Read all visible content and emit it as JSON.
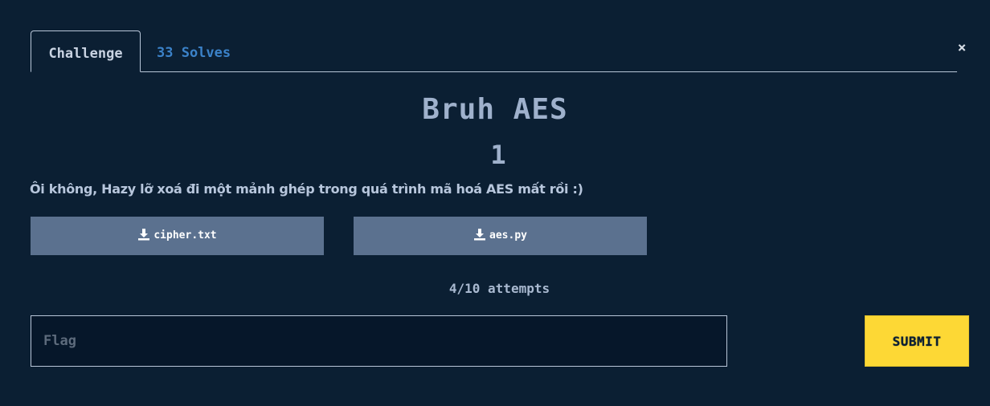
{
  "tabs": {
    "challenge_label": "Challenge",
    "solves_label": "33 Solves"
  },
  "close_icon": "×",
  "challenge": {
    "name": "Bruh AES",
    "points": "1",
    "description": "Ôi không, Hazy lỡ xoá đi một mảnh ghép trong quá trình mã hoá AES mất rồi :)"
  },
  "files": [
    {
      "name": "cipher.txt",
      "icon": "download-icon"
    },
    {
      "name": "aes.py",
      "icon": "download-icon"
    }
  ],
  "attempts": "4/10 attempts",
  "flag": {
    "placeholder": "Flag",
    "value": ""
  },
  "submit_label": "SUBMIT",
  "colors": {
    "background": "#0b1f33",
    "accent_link": "#3b82c9",
    "file_button": "#5b718f",
    "submit_button": "#fdd835"
  }
}
